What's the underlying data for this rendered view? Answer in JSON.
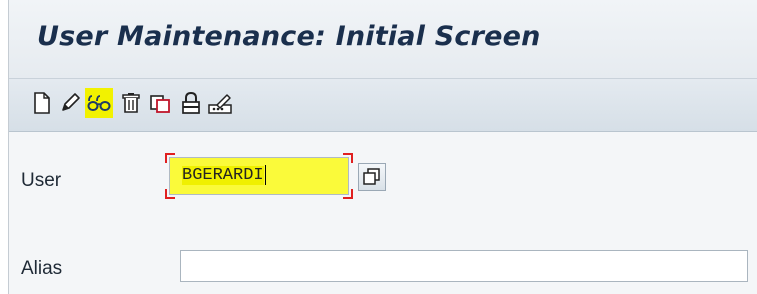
{
  "screen": {
    "title": "User Maintenance: Initial Screen"
  },
  "toolbar": {
    "buttons": [
      {
        "name": "create-icon",
        "highlighted": false
      },
      {
        "name": "pencil-icon",
        "highlighted": false
      },
      {
        "name": "glasses-icon",
        "highlighted": true
      },
      {
        "name": "trash-icon",
        "highlighted": false
      },
      {
        "name": "copy-icon",
        "highlighted": false
      },
      {
        "name": "lock-icon",
        "highlighted": false
      },
      {
        "name": "change-password-icon",
        "highlighted": false
      }
    ]
  },
  "form": {
    "user_label": "User",
    "user_value": "BGERARDI",
    "alias_label": "Alias",
    "alias_value": ""
  },
  "colors": {
    "highlight": "#f2f200",
    "title": "#1a2f4d",
    "focus_corners": "#e02020"
  }
}
